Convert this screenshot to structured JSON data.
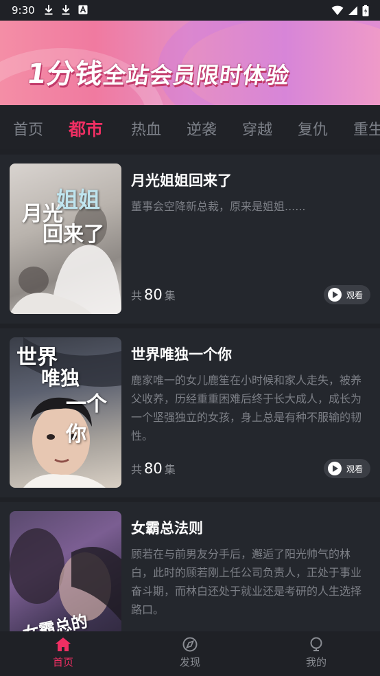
{
  "status_bar": {
    "time": "9:30",
    "icons": [
      "download-icon",
      "download-icon",
      "a-icon",
      "wifi-icon",
      "signal-icon",
      "battery-icon"
    ]
  },
  "banner": {
    "text_big": "1分钱",
    "text_small": "全站会员限时体验"
  },
  "tabs": [
    {
      "label": "首页",
      "active": false
    },
    {
      "label": "都市",
      "active": true
    },
    {
      "label": "热血",
      "active": false
    },
    {
      "label": "逆袭",
      "active": false
    },
    {
      "label": "穿越",
      "active": false
    },
    {
      "label": "复仇",
      "active": false
    },
    {
      "label": "重生",
      "active": false
    }
  ],
  "dramas": [
    {
      "title": "月光姐姐回来了",
      "description": "董事会空降新总裁，原来是姐姐......",
      "episodes_prefix": "共",
      "episodes": "80",
      "episodes_suffix": "集",
      "watch_label": "观看",
      "poster_text_a": "月光",
      "poster_text_b": "姐姐",
      "poster_text_c": "回来了"
    },
    {
      "title": "世界唯独一个你",
      "description": "鹿家唯一的女儿鹿笙在小时候和家人走失，被养父收养，历经重重困难后终于长大成人，成长为一个坚强独立的女孩，身上总是有种不服输的韧性。",
      "episodes_prefix": "共",
      "episodes": "80",
      "episodes_suffix": "集",
      "watch_label": "观看",
      "poster_text_a": "世界",
      "poster_text_b": "唯独",
      "poster_text_c": "一个你"
    },
    {
      "title": "女霸总法则",
      "description": "顾若在与前男友分手后，邂逅了阳光帅气的林白，此时的顾若刚上任公司负责人，正处于事业奋斗期，而林白还处于就业还是考研的人生选择路口。",
      "episodes_prefix": "",
      "episodes": "",
      "episodes_suffix": "",
      "watch_label": "",
      "poster_text_a": "女霸总的",
      "poster_text_b": "",
      "poster_text_c": ""
    }
  ],
  "bottom_nav": [
    {
      "label": "首页",
      "icon": "home-icon",
      "active": true
    },
    {
      "label": "发现",
      "icon": "discover-icon",
      "active": false
    },
    {
      "label": "我的",
      "icon": "profile-icon",
      "active": false
    }
  ],
  "colors": {
    "accent": "#ef2f63",
    "background": "#1f2126",
    "card": "#24272d"
  }
}
